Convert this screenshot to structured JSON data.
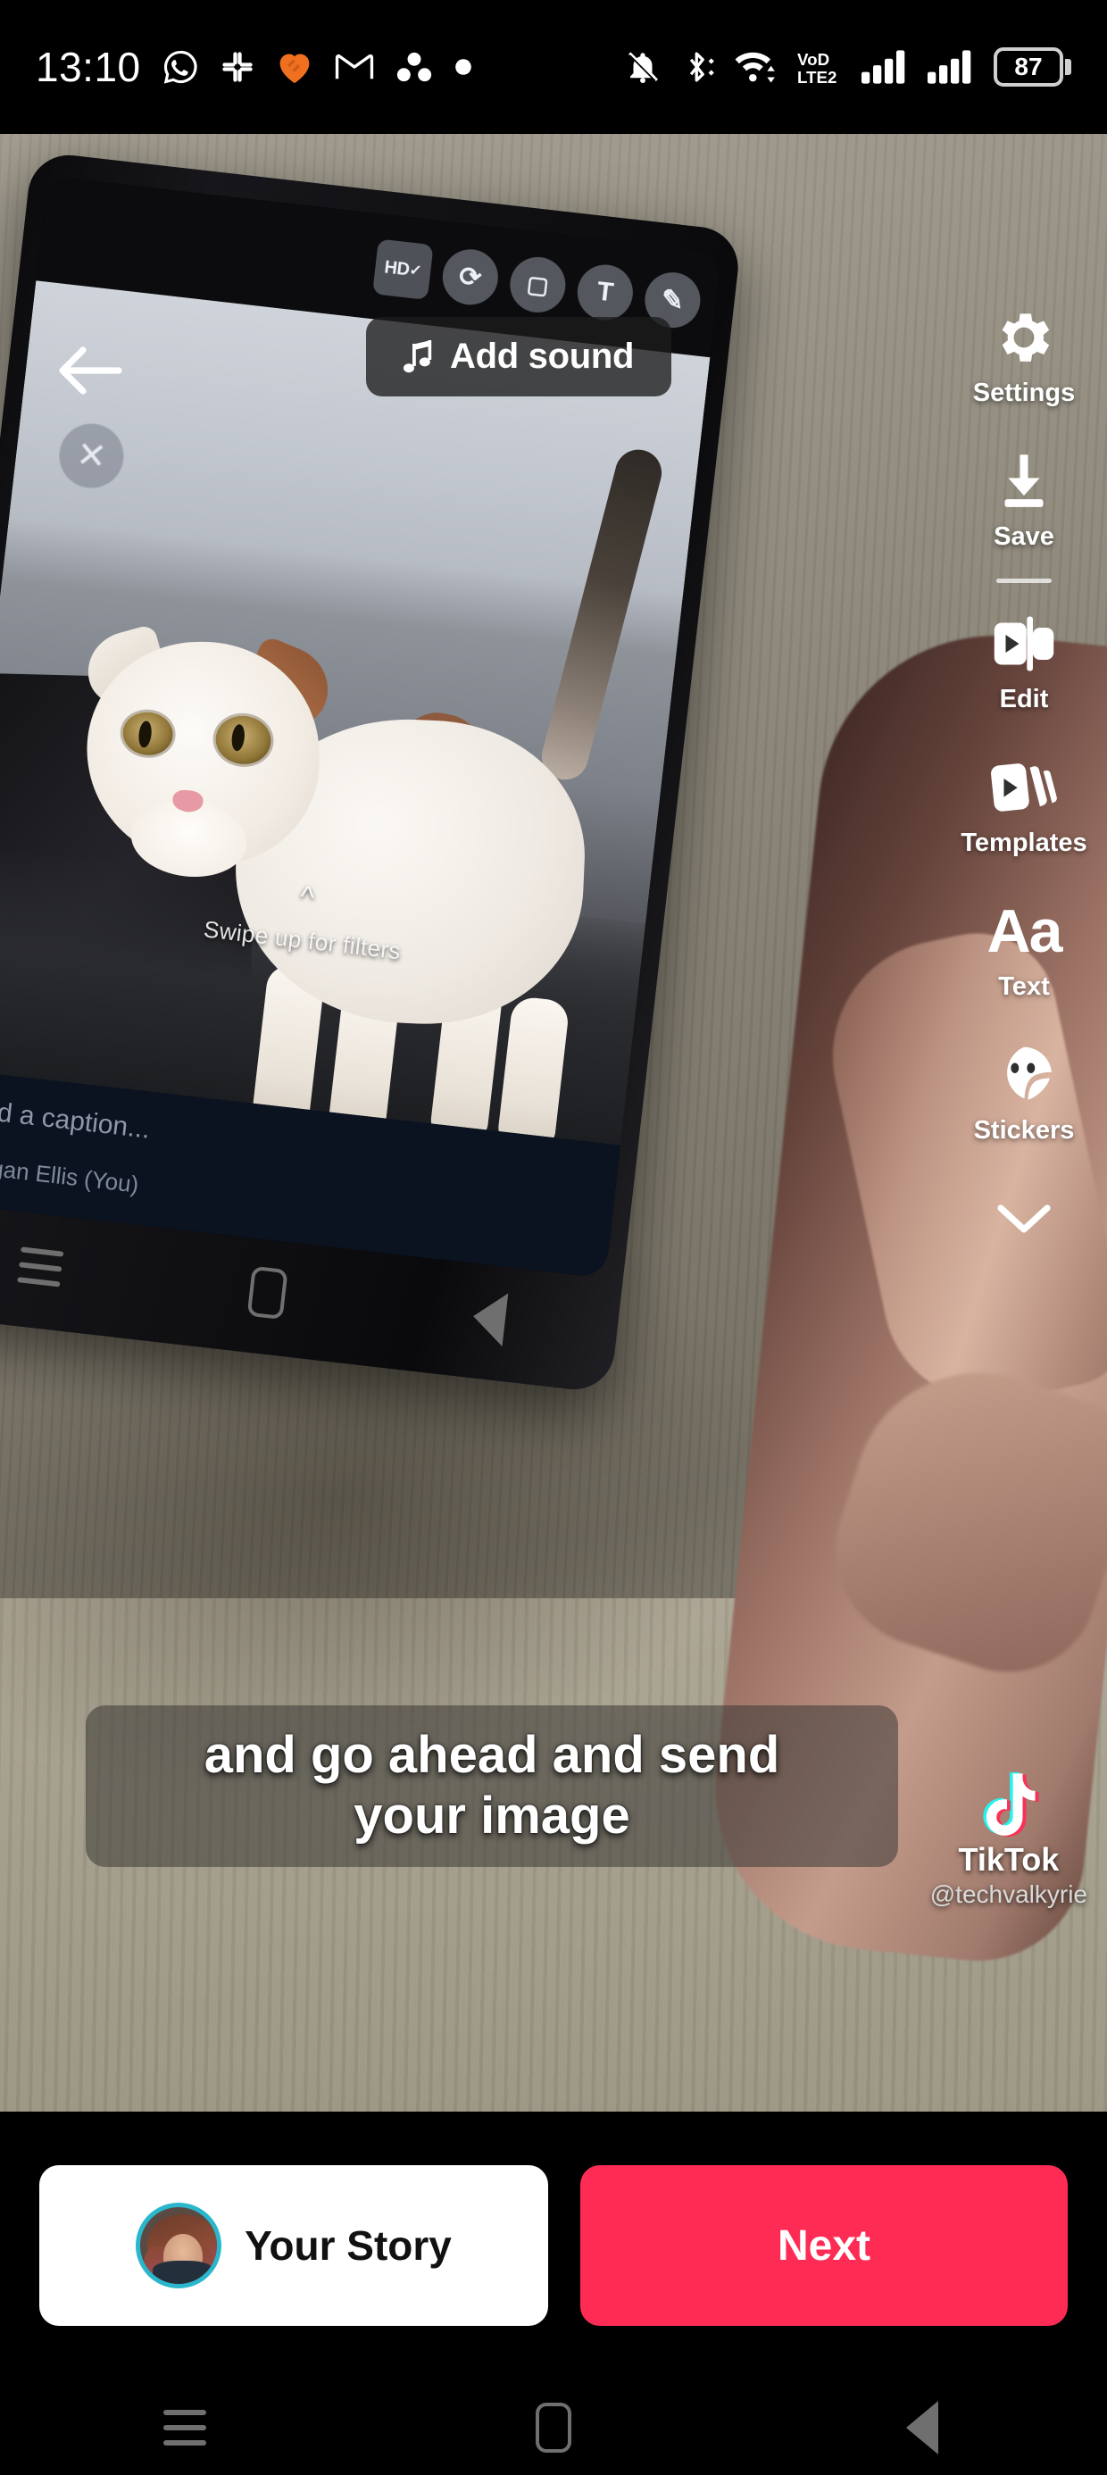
{
  "status_bar": {
    "time": "13:10",
    "left_icons": [
      "whatsapp-icon",
      "slack-icon",
      "heart-app-icon",
      "gmail-icon",
      "asana-icon",
      "dot-icon"
    ],
    "right_icons": [
      "mute-icon",
      "bluetooth-icon",
      "wifi-icon",
      "volte-icon",
      "signal-1-icon",
      "signal-2-icon"
    ],
    "volte_label": "VoLTE2",
    "battery_percent": "87"
  },
  "top_bar": {
    "back_icon": "back-arrow-icon",
    "add_sound_label": "Add sound",
    "music_note_icon": "music-note-icon"
  },
  "rail": {
    "items": [
      {
        "label": "Settings",
        "icon": "gear-icon"
      },
      {
        "label": "Save",
        "icon": "download-icon"
      },
      {
        "label": "Edit",
        "icon": "edit-clip-icon"
      },
      {
        "label": "Templates",
        "icon": "templates-icon"
      },
      {
        "label": "Text",
        "icon": "text-aa-icon",
        "glyph": "Aa"
      },
      {
        "label": "Stickers",
        "icon": "sticker-face-icon"
      }
    ],
    "expand_icon": "chevron-down-icon"
  },
  "video": {
    "caption_line_1": "and go ahead and send",
    "caption_line_2": "your image",
    "watermark": {
      "logo_icon": "tiktok-logo-icon",
      "name": "TikTok",
      "handle": "@techvalkyrie"
    },
    "inner_phone": {
      "toolbar": [
        {
          "icon": "hd-check-icon",
          "glyph": "HD"
        },
        {
          "icon": "crop-rotate-icon",
          "glyph": "⟳"
        },
        {
          "icon": "sticker-icon",
          "glyph": "▢"
        },
        {
          "icon": "text-tool-icon",
          "glyph": "T"
        },
        {
          "icon": "pencil-icon",
          "glyph": "✎"
        }
      ],
      "close_icon": "close-x-icon",
      "close_glyph": "✕",
      "filters_hint": "Swipe up for filters",
      "filters_chevron_icon": "chevron-up-icon",
      "caption_placeholder": "Add a caption...",
      "recipient": "Megan Ellis (You)",
      "nav": [
        "recents-icon",
        "home-icon",
        "back-icon"
      ]
    }
  },
  "action_bar": {
    "story_label": "Your Story",
    "story_avatar_icon": "avatar",
    "next_label": "Next"
  },
  "nav_bar": {
    "recents_icon": "recents-icon",
    "home_icon": "home-icon",
    "back_icon": "back-icon"
  },
  "colors": {
    "next_button": "#FE2C55",
    "avatar_ring": "#2AB7CD",
    "status_bar_bg": "#000000",
    "heart_icon": "#F07020"
  }
}
